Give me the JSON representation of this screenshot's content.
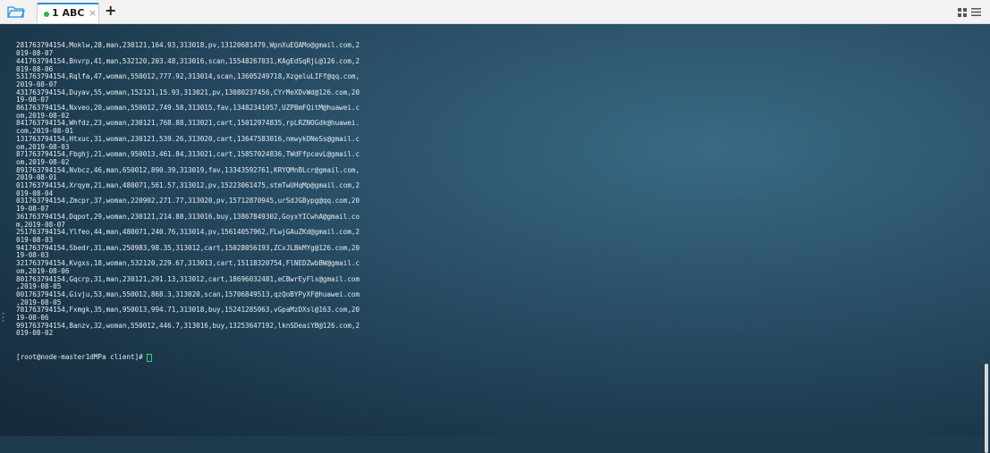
{
  "tab": {
    "label": "1 ABC",
    "close": "×",
    "new": "+"
  },
  "terminal": {
    "lines": [
      "281763794154,Moklw,28,man,230121,164.93,313018,pv,13120681479,WpnXuEQAMo@gmail.com,2",
      "019-08-07",
      "441763794154,Bnvrp,41,man,532120,203.48,313016,scan,15548267031,KAgEdSqRjL@126.com,2",
      "019-08-06",
      "531763794154,Rqlfa,47,woman,550012,777.92,313014,scan,13605249718,XzgeluLIFf@qq.com,",
      "2019-08-07",
      "431763794154,Duyav,55,woman,152121,15.93,313021,pv,13080237456,CYrMeXDvWd@126.com,20",
      "19-08-07",
      "861763794154,Nxveo,20,woman,550012,749.58,313015,fav,13482341057,UZPBmFQitM@huawei.c",
      "om,2019-08-02",
      "841763794154,Whfdz,23,woman,230121,768.88,313021,cart,15012974835,rpLRZNOGdk@huawei.",
      "com,2019-08-01",
      "131763794154,Htxuc,31,woman,230121,539.26,313020,cart,13647583016,nmwykDNeSs@gmail.c",
      "om,2019-08-03",
      "871763794154,Fbghj,21,woman,950013,461.84,313021,cart,15857024836,TWdFfpcavL@gmail.c",
      "om,2019-08-02",
      "891763794154,Nvbcz,46,man,650012,890.39,313019,fav,13343592761,KRYQMnBLcr@gmail.com,",
      "2019-08-01",
      "011763794154,Xrqym,21,man,480071,561.57,313012,pv,15223061475,stmTwUHqMp@gmail.com,2",
      "019-08-04",
      "031763794154,Zmcpr,37,woman,220902,271.77,313020,pv,15712870945,urSdJGBypg@qq.com,20",
      "19-08-07",
      "361763794154,Dqpot,29,woman,230121,214.88,313016,buy,13867849302,GoyxYICwhA@gmail.co",
      "m,2019-08-07",
      "251763794154,Ylfeo,44,man,480071,240.76,313014,pv,15614057962,FLwjGAuZKd@gmail.com,2",
      "019-08-03",
      "941763794154,Sbedr,31,man,250983,98.35,313012,cart,15028056193,ZCxJLBkMYg@126.com,20",
      "19-08-03",
      "321763794154,Kvgxs,18,woman,532120,229.67,313013,cart,15118320754,FlNEDZwbBW@gmail.c",
      "om,2019-08-06",
      "801763794154,Gqcrp,31,man,230121,291.13,313012,cart,18696032481,eCBwrEyFls@gmail.com",
      ",2019-08-05",
      "001763794154,Givju,53,man,550012,868.3,313020,scan,15706849513,qzQoBYPyXF@huawei.com",
      ",2019-08-05",
      "781763794154,Fxmgk,35,man,950013,994.71,313018,buy,15241285063,vGpaMzDXsl@163.com,20",
      "19-08-06",
      "991763794154,Banzv,32,woman,550012,446.7,313016,buy,13253647192,lknSDeaiYB@126.com,2",
      "019-08-02"
    ],
    "prompt": "[root@node-master1dMPa client]#"
  },
  "colors": {
    "accent": "#2b8fd6",
    "status_dot": "#2fb54a",
    "cursor": "#33d17a"
  },
  "icons": {
    "folder": "folder-icon",
    "grid": "grid-view-icon",
    "menu": "menu-icon"
  }
}
